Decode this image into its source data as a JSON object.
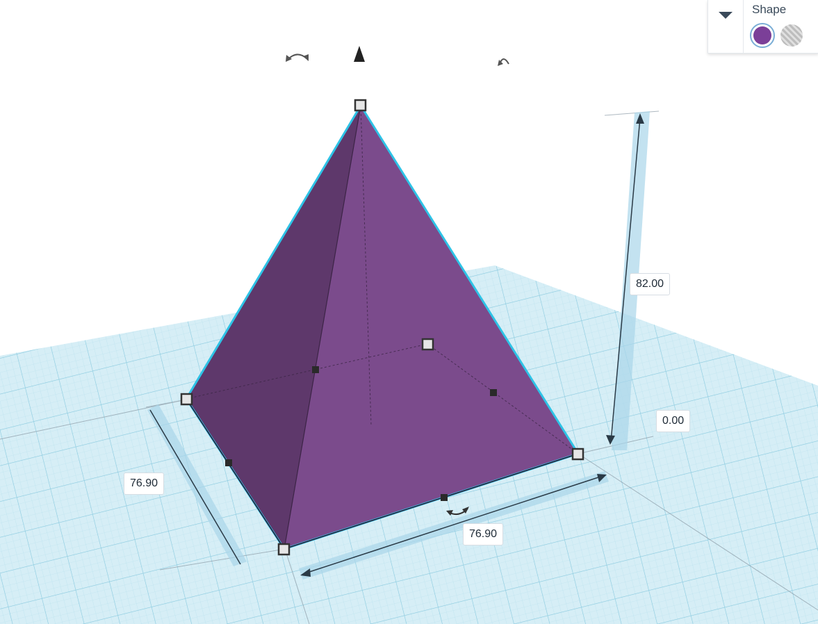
{
  "colors": {
    "shape_main": "#7b4b8c",
    "shape_dark": "#5e386b",
    "outline": "#2ec3e6",
    "workplane": "#d6eef6",
    "grid_line": "#a8d7e8",
    "dimension_band": "#a9d6ea",
    "handle_fill": "#e6e6e6",
    "handle_stroke": "#333333",
    "solid_swatch": "#7b3f98"
  },
  "dimensions": {
    "height": "82.00",
    "elevation": "0.00",
    "length": "76.90",
    "width": "76.90"
  },
  "shape_panel": {
    "title": "Shape",
    "toggle_icon": "caret-down-icon",
    "solid_icon": "solid-color-swatch",
    "hole_icon": "hole-swatch"
  },
  "gizmo_icons": [
    "rotate-arrow-icon",
    "lift-cone-icon",
    "rotate-arrow-icon",
    "rotate-arrow-icon"
  ]
}
